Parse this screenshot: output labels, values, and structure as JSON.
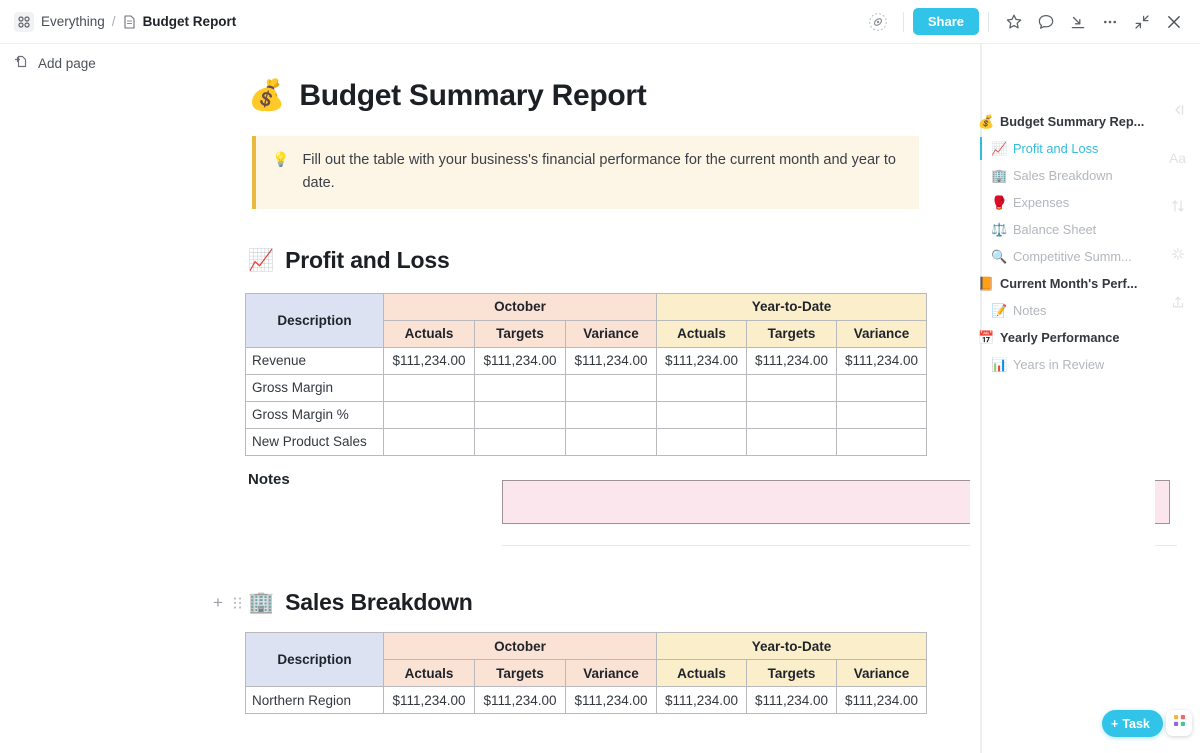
{
  "topbar": {
    "breadcrumb_root": "Everything",
    "breadcrumb_sep": "/",
    "breadcrumb_current": "Budget Report",
    "share_label": "Share",
    "icons": {
      "apps_grid": "apps-grid-icon",
      "doc": "document-icon",
      "privacy": "privacy-eye-icon",
      "star": "star-icon",
      "comment": "comment-icon",
      "download": "download-icon",
      "more": "more-horizontal-icon",
      "collapse": "collapse-icon",
      "close": "close-icon"
    }
  },
  "leftrail": {
    "add_page_label": "Add page"
  },
  "document": {
    "emoji": "💰",
    "title": "Budget Summary Report",
    "callout": {
      "emoji": "💡",
      "text": "Fill out the table with your business's financial performance for the current month and year to date."
    },
    "sections": [
      {
        "emoji": "📈",
        "title": "Profit and Loss",
        "table": {
          "group_headers": [
            "Description",
            "October",
            "Year-to-Date"
          ],
          "sub_headers": [
            "Actuals",
            "Targets",
            "Variance",
            "Actuals",
            "Targets",
            "Variance"
          ],
          "rows": [
            {
              "description": "Revenue",
              "values": [
                "$111,234.00",
                "$111,234.00",
                "$111,234.00",
                "$111,234.00",
                "$111,234.00",
                "$111,234.00"
              ]
            },
            {
              "description": "Gross Margin",
              "values": [
                "",
                "",
                "",
                "",
                "",
                ""
              ]
            },
            {
              "description": "Gross Margin %",
              "values": [
                "",
                "",
                "",
                "",
                "",
                ""
              ]
            },
            {
              "description": "New Product Sales",
              "values": [
                "",
                "",
                "",
                "",
                "",
                ""
              ]
            }
          ]
        },
        "notes_label": "Notes",
        "notes_value": ""
      },
      {
        "emoji": "🏢",
        "title": "Sales Breakdown",
        "table": {
          "group_headers": [
            "Description",
            "October",
            "Year-to-Date"
          ],
          "sub_headers": [
            "Actuals",
            "Targets",
            "Variance",
            "Actuals",
            "Targets",
            "Variance"
          ],
          "rows": [
            {
              "description": "Northern Region",
              "values": [
                "$111,234.00",
                "$111,234.00",
                "$111,234.00",
                "$111,234.00",
                "$111,234.00",
                "$111,234.00"
              ]
            }
          ]
        }
      }
    ]
  },
  "outline": {
    "items": [
      {
        "emoji": "💰",
        "label": "Budget Summary Rep...",
        "level": "top",
        "active": false
      },
      {
        "emoji": "📈",
        "label": "Profit and Loss",
        "level": "child",
        "active": true
      },
      {
        "emoji": "🏢",
        "label": "Sales Breakdown",
        "level": "child",
        "active": false
      },
      {
        "emoji": "🥊",
        "label": "Expenses",
        "level": "child",
        "active": false
      },
      {
        "emoji": "⚖️",
        "label": "Balance Sheet",
        "level": "child",
        "active": false
      },
      {
        "emoji": "🔍",
        "label": "Competitive Summ...",
        "level": "child",
        "active": false
      },
      {
        "emoji": "📙",
        "label": "Current Month's Perf...",
        "level": "top",
        "active": false
      },
      {
        "emoji": "📝",
        "label": "Notes",
        "level": "child",
        "active": false
      },
      {
        "emoji": "📅",
        "label": "Yearly Performance",
        "level": "top",
        "active": false
      },
      {
        "emoji": "📊",
        "label": "Years in Review",
        "level": "child",
        "active": false
      }
    ]
  },
  "iconrail": {
    "items": [
      {
        "name": "collapse-panel-icon",
        "glyph": "←|"
      },
      {
        "name": "font-size-icon",
        "glyph": "Aa"
      },
      {
        "name": "convert-icon",
        "glyph": "⇅"
      },
      {
        "name": "ai-sparkle-icon",
        "glyph": "✦"
      },
      {
        "name": "share-export-icon",
        "glyph": "⇧"
      }
    ]
  },
  "footer": {
    "task_label": "Task",
    "task_plus": "+",
    "apps_icon": "apps-launcher-icon"
  },
  "colors": {
    "accent": "#32c4e8",
    "callout_bg": "#fdf6e6",
    "callout_border": "#e8b93c",
    "header_desc": "#dde2f2",
    "header_october": "#fae2d5",
    "header_ytd": "#faeecb",
    "notes_bg": "#fbe6ee"
  }
}
